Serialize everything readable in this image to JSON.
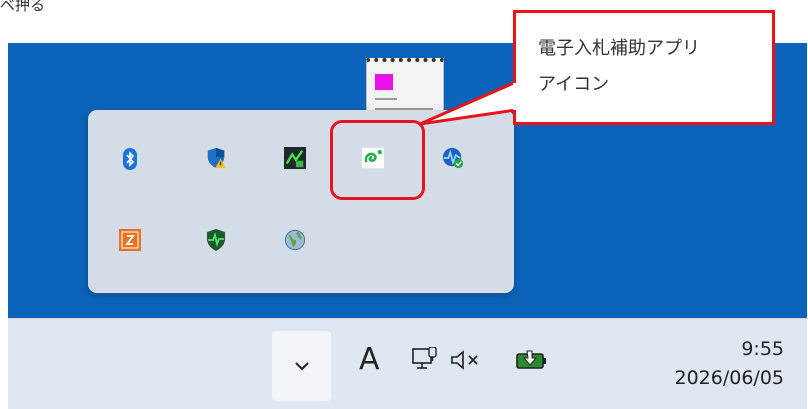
{
  "top_text": "べ押る",
  "callout": {
    "line1": "電子入札補助アプリ",
    "line2": "アイコン"
  },
  "tray_icons": [
    {
      "name": "bluetooth-icon"
    },
    {
      "name": "security-warning-icon"
    },
    {
      "name": "green-app-icon"
    },
    {
      "name": "e-bid-helper-app-icon"
    },
    {
      "name": "network-status-icon"
    },
    {
      "name": "orange-app-icon"
    },
    {
      "name": "shield-pulse-icon"
    },
    {
      "name": "globe-icon"
    }
  ],
  "taskbar": {
    "ime_indicator": "A",
    "time": "9:55",
    "date": "2026/06/05",
    "icons": [
      "chevron-down-icon",
      "network-icon",
      "volume-muted-icon",
      "battery-charging-icon"
    ]
  },
  "colors": {
    "desktop": "#0a63b8",
    "popup": "#d4dce8",
    "highlight": "#e8141c",
    "taskbar": "#dfe7f2"
  }
}
